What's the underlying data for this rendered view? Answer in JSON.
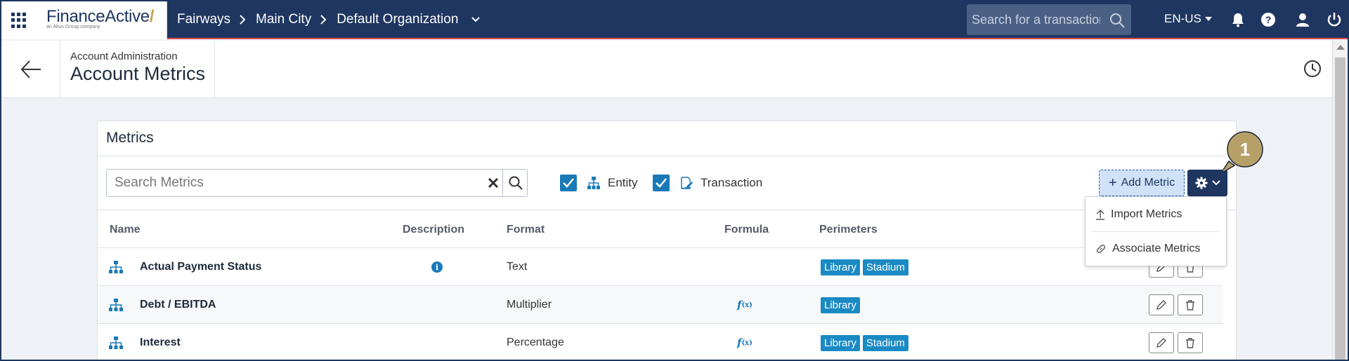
{
  "app": {
    "logo_main": "FinanceActive",
    "logo_sub": "an Altus Group company"
  },
  "breadcrumb": {
    "items": [
      "Fairways",
      "Main City",
      "Default Organization"
    ]
  },
  "topbar": {
    "search_placeholder": "Search for a transaction",
    "language": "EN-US",
    "icons": [
      "bell-icon",
      "help-icon",
      "user-icon",
      "power-icon"
    ]
  },
  "page": {
    "section": "Account Administration",
    "title": "Account Metrics"
  },
  "metrics": {
    "title": "Metrics",
    "search_placeholder": "Search Metrics",
    "filters": {
      "entity_label": "Entity",
      "entity_checked": true,
      "transaction_label": "Transaction",
      "transaction_checked": true
    },
    "add_label": "Add Metric",
    "columns": [
      "Name",
      "Description",
      "Format",
      "Formula",
      "Perimeters"
    ],
    "rows": [
      {
        "name": "Actual Payment Status",
        "has_description": true,
        "format": "Text",
        "has_formula": false,
        "perimeters": [
          "Library",
          "Stadium"
        ]
      },
      {
        "name": "Debt / EBITDA",
        "has_description": false,
        "format": "Multiplier",
        "has_formula": true,
        "perimeters": [
          "Library"
        ]
      },
      {
        "name": "Interest",
        "has_description": false,
        "format": "Percentage",
        "has_formula": true,
        "perimeters": [
          "Library",
          "Stadium"
        ]
      }
    ],
    "formula_glyph": "f",
    "formula_arg": "(x)",
    "info_glyph": "i"
  },
  "dropdown": {
    "items": [
      "Import Metrics",
      "Associate Metrics"
    ]
  },
  "callout": {
    "number": "1"
  },
  "colors": {
    "navy": "#1e3660",
    "accent_blue": "#1a7ab8",
    "tag_blue": "#1a8ac4",
    "callout_gold": "#b7a068"
  }
}
